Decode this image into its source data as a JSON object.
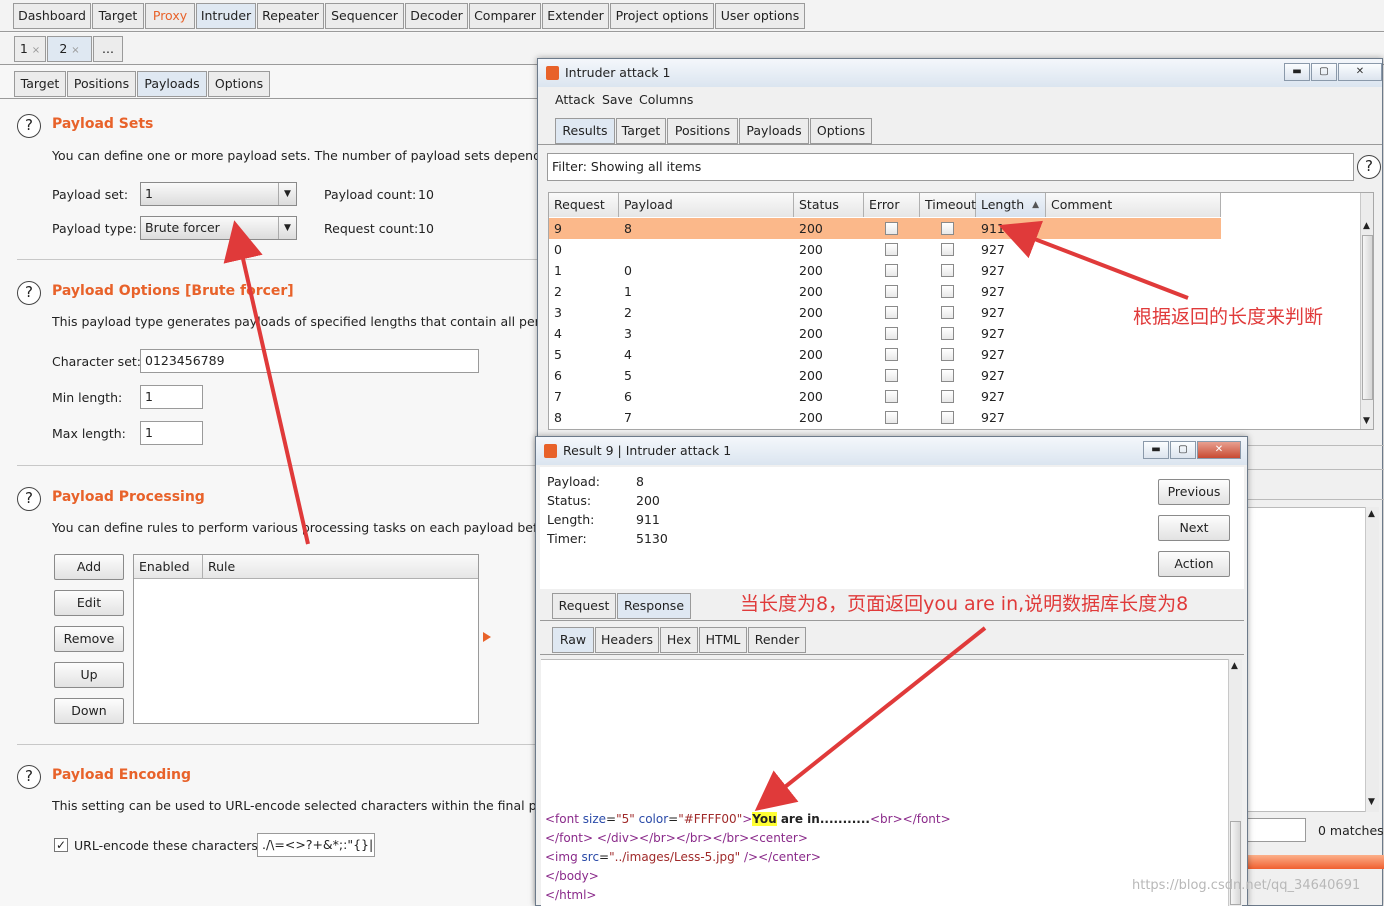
{
  "main_tabs": [
    {
      "label": "Dashboard"
    },
    {
      "label": "Target"
    },
    {
      "label": "Proxy"
    },
    {
      "label": "Intruder"
    },
    {
      "label": "Repeater"
    },
    {
      "label": "Sequencer"
    },
    {
      "label": "Decoder"
    },
    {
      "label": "Comparer"
    },
    {
      "label": "Extender"
    },
    {
      "label": "Project options"
    },
    {
      "label": "User options"
    }
  ],
  "attack_tabs": [
    {
      "label": "1",
      "close": "×"
    },
    {
      "label": "2",
      "close": "×"
    },
    {
      "label": "..."
    }
  ],
  "intruder_tabs": [
    {
      "label": "Target"
    },
    {
      "label": "Positions"
    },
    {
      "label": "Payloads"
    },
    {
      "label": "Options"
    }
  ],
  "payload_sets": {
    "title": "Payload Sets",
    "desc": "You can define one or more payload sets. The number of payload sets depends on t",
    "set_label": "Payload set:",
    "set_value": "1",
    "type_label": "Payload type:",
    "type_value": "Brute forcer",
    "count_label": "Payload count:",
    "count_value": "10",
    "req_label": "Request count:",
    "req_value": "10"
  },
  "payload_options": {
    "title": "Payload Options [Brute forcer]",
    "desc": "This payload type generates payloads of specified lengths that contain all permutatio",
    "charset_label": "Character set:",
    "charset_value": "0123456789",
    "min_label": "Min length:",
    "min_value": "1",
    "max_label": "Max length:",
    "max_value": "1"
  },
  "payload_processing": {
    "title": "Payload Processing",
    "desc": "You can define rules to perform various processing tasks on each payload before it i",
    "buttons": [
      "Add",
      "Edit",
      "Remove",
      "Up",
      "Down"
    ],
    "col_enabled": "Enabled",
    "col_rule": "Rule"
  },
  "payload_encoding": {
    "title": "Payload Encoding",
    "desc": "This setting can be used to URL-encode selected characters within the final payload",
    "checkbox_label": "URL-encode these characters:",
    "chars_value": "./\\=<>?+&*;:\"{}|^`"
  },
  "attack_window": {
    "title": "Intruder attack 1",
    "menu": [
      "Attack",
      "Save",
      "Columns"
    ],
    "tabs": [
      {
        "label": "Results"
      },
      {
        "label": "Target"
      },
      {
        "label": "Positions"
      },
      {
        "label": "Payloads"
      },
      {
        "label": "Options"
      }
    ],
    "filter": "Filter: Showing all items",
    "columns": [
      "Request",
      "Payload",
      "Status",
      "Error",
      "Timeout",
      "Length",
      "Comment"
    ],
    "sort_indicator": "▲",
    "rows": [
      {
        "request": "9",
        "payload": "8",
        "status": "200",
        "length": "911"
      },
      {
        "request": "0",
        "payload": "",
        "status": "200",
        "length": "927"
      },
      {
        "request": "1",
        "payload": "0",
        "status": "200",
        "length": "927"
      },
      {
        "request": "2",
        "payload": "1",
        "status": "200",
        "length": "927"
      },
      {
        "request": "3",
        "payload": "2",
        "status": "200",
        "length": "927"
      },
      {
        "request": "4",
        "payload": "3",
        "status": "200",
        "length": "927"
      },
      {
        "request": "5",
        "payload": "4",
        "status": "200",
        "length": "927"
      },
      {
        "request": "6",
        "payload": "5",
        "status": "200",
        "length": "927"
      },
      {
        "request": "7",
        "payload": "6",
        "status": "200",
        "length": "927"
      },
      {
        "request": "8",
        "payload": "7",
        "status": "200",
        "length": "927"
      }
    ],
    "matches": "0 matches"
  },
  "result_window": {
    "title": "Result 9 | Intruder attack 1",
    "payload_label": "Payload:",
    "payload_value": "8",
    "status_label": "Status:",
    "status_value": "200",
    "length_label": "Length:",
    "length_value": "911",
    "timer_label": "Timer:",
    "timer_value": "5130",
    "buttons": [
      "Previous",
      "Next",
      "Action"
    ],
    "tabs": [
      {
        "label": "Request"
      },
      {
        "label": "Response"
      }
    ],
    "view_tabs": [
      {
        "label": "Raw"
      },
      {
        "label": "Headers"
      },
      {
        "label": "Hex"
      },
      {
        "label": "HTML"
      },
      {
        "label": "Render"
      }
    ],
    "code": {
      "l1_open": "<font ",
      "l1_size_attr": "size",
      "l1_eq1": "=",
      "l1_size_val": "\"5\"",
      "l1_sp": " ",
      "l1_color_attr": "color",
      "l1_eq2": "=",
      "l1_color_val": "\"#FFFF00\"",
      "l1_gt": ">",
      "l1_you": "You",
      "l1_rest": " are in...........",
      "l1_br": "<br>",
      "l1_close": "</font>",
      "l2": "</font> </div></br></br></br><center>",
      "l3_open": "<img ",
      "l3_attr": "src",
      "l3_eq": "=",
      "l3_val": "\"../images/Less-5.jpg\"",
      "l3_close": " /></center>",
      "l4": "</body>",
      "l5": "</html>"
    }
  },
  "annotations": {
    "length_note": "根据返回的长度来判断",
    "you_are_in_note": "当长度为8，页面返回you are in,说明数据库长度为8"
  },
  "watermark": "https://blog.csdn.net/qq_34640691",
  "colors": {
    "accent": "#e8622a",
    "annotation": "#e03a3a",
    "selected_row": "#fbb88a",
    "highlight": "#ffff33"
  }
}
